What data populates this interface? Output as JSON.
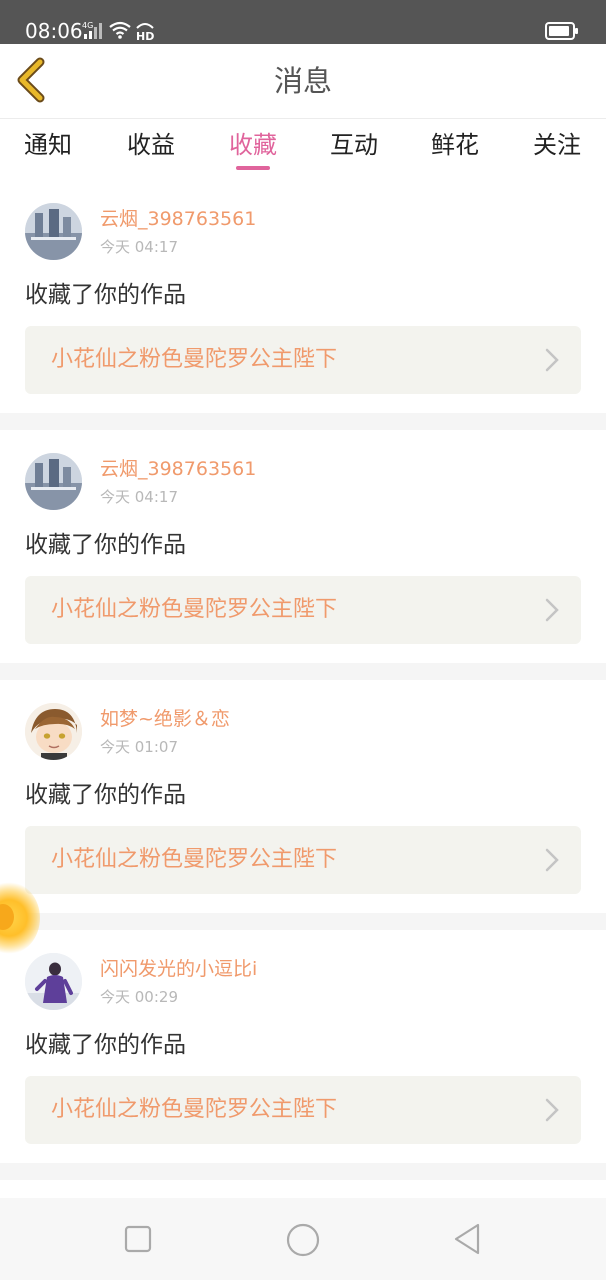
{
  "status_bar": {
    "time": "08:06",
    "network": "4G",
    "hd": "HD"
  },
  "header": {
    "title": "消息"
  },
  "tabs": [
    {
      "label": "通知",
      "active": false
    },
    {
      "label": "收益",
      "active": false
    },
    {
      "label": "收藏",
      "active": true
    },
    {
      "label": "互动",
      "active": false
    },
    {
      "label": "鲜花",
      "active": false
    },
    {
      "label": "关注",
      "active": false
    }
  ],
  "messages": [
    {
      "username": "云烟_398763561",
      "time": "今天 04:17",
      "action": "收藏了你的作品",
      "work_title": "小花仙之粉色曼陀罗公主陛下"
    },
    {
      "username": "云烟_398763561",
      "time": "今天 04:17",
      "action": "收藏了你的作品",
      "work_title": "小花仙之粉色曼陀罗公主陛下"
    },
    {
      "username": "如梦~绝影＆恋",
      "time": "今天 01:07",
      "action": "收藏了你的作品",
      "work_title": "小花仙之粉色曼陀罗公主陛下"
    },
    {
      "username": "闪闪发光的小逗比i",
      "time": "今天 00:29",
      "action": "收藏了你的作品",
      "work_title": "小花仙之粉色曼陀罗公主陛下"
    }
  ],
  "colors": {
    "accent": "#e0649c",
    "username": "#f09a6c",
    "back_icon": "#e8b82a"
  }
}
